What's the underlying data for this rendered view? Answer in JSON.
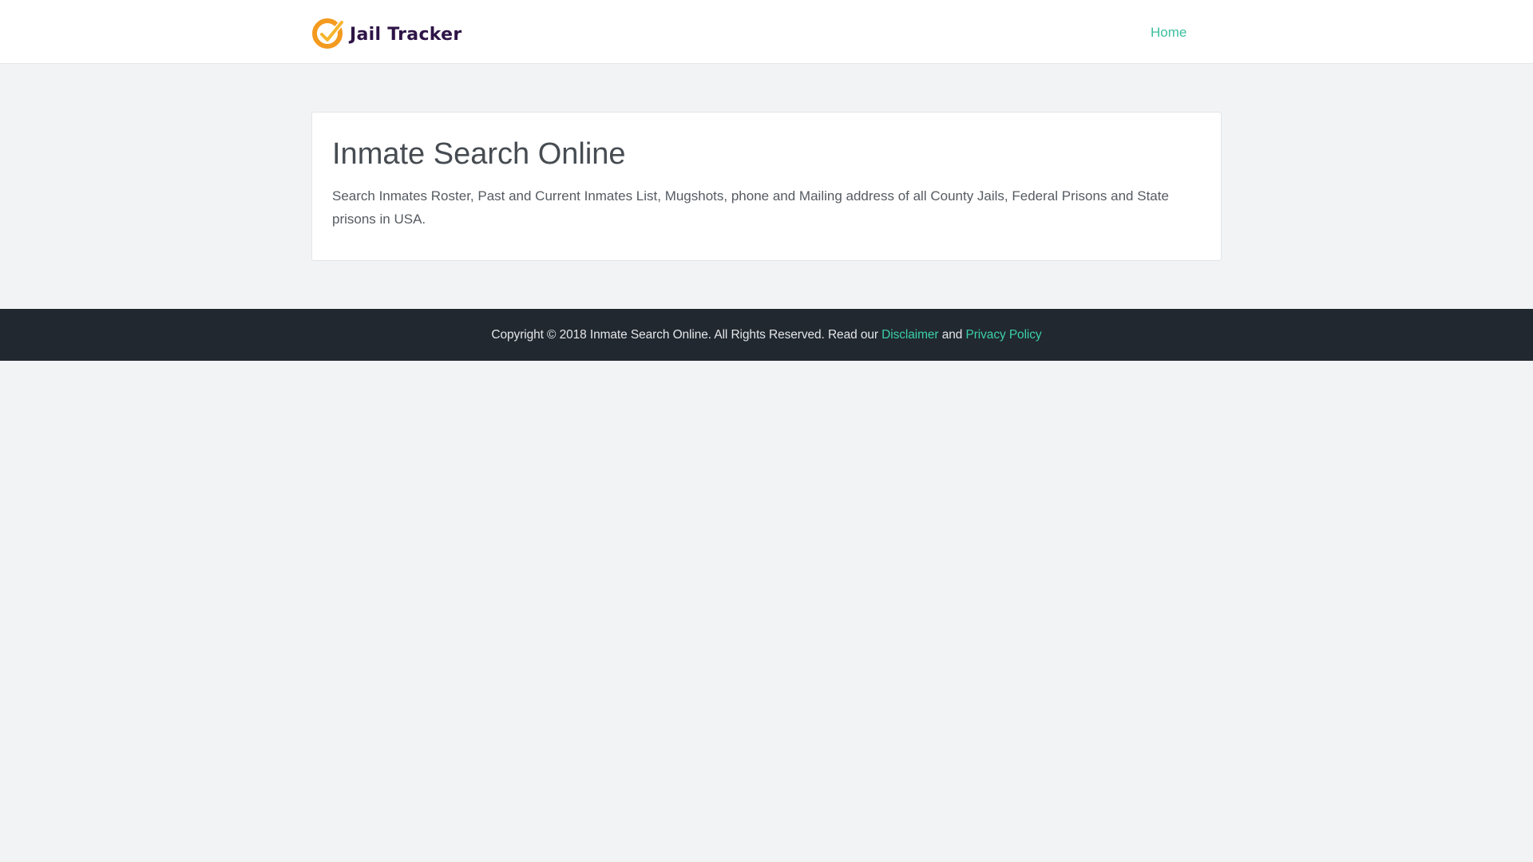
{
  "header": {
    "brand_name": "Jail Tracker",
    "logo_icon": "check-circle-logo-icon",
    "nav": {
      "home_label": "Home"
    }
  },
  "main": {
    "title": "Inmate Search Online",
    "description": "Search Inmates Roster, Past and Current Inmates List, Mugshots, phone and Mailing address of all County Jails, Federal Prisons and State prisons in USA."
  },
  "footer": {
    "copyright_text": "Copyright © 2018 Inmate Search Online. All Rights Reserved. Read our",
    "disclaimer_label": "Disclaimer",
    "and_text": "and",
    "privacy_label": "Privacy Policy"
  },
  "colors": {
    "accent": "#3bbf9f",
    "page_background": "#f2f3f5",
    "footer_background": "#212830",
    "brand_text": "#2e1446",
    "logo_orange": "#f39a1f"
  }
}
